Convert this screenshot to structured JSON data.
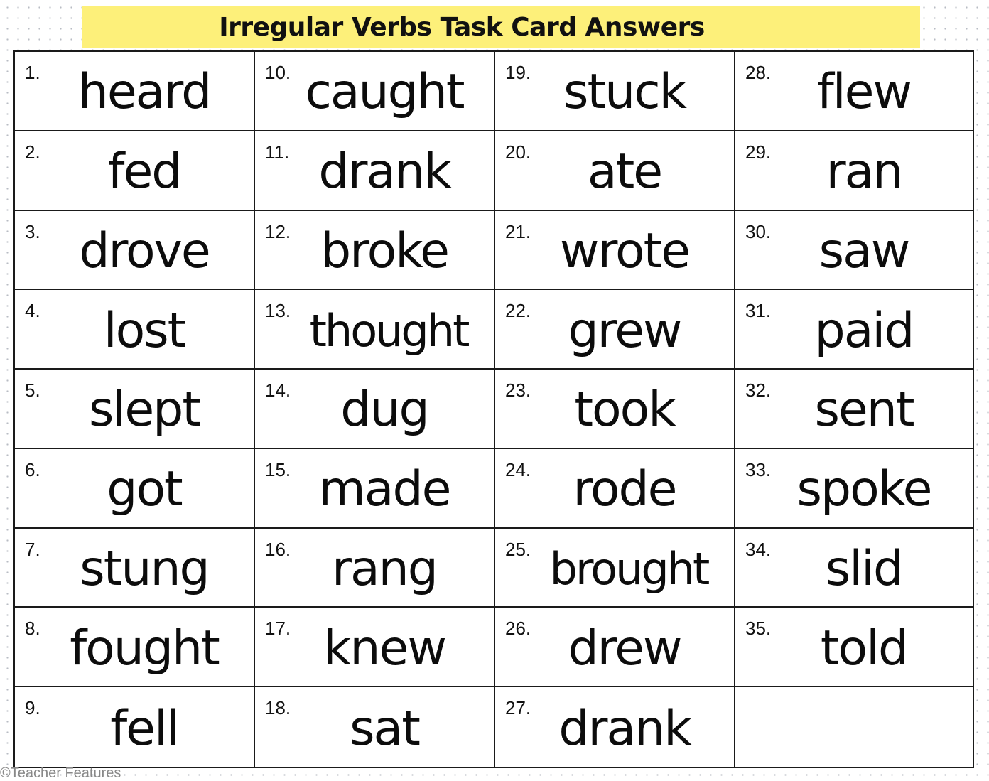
{
  "title": "Irregular Verbs Task Card Answers",
  "colors": {
    "banner": "#fdf07a",
    "grid_lines": "#1a1a1a",
    "text": "#0c0c0c"
  },
  "columns": [
    [
      {
        "number": "1.",
        "answer": "heard"
      },
      {
        "number": "2.",
        "answer": "fed"
      },
      {
        "number": "3.",
        "answer": "drove"
      },
      {
        "number": "4.",
        "answer": "lost"
      },
      {
        "number": "5.",
        "answer": "slept"
      },
      {
        "number": "6.",
        "answer": "got"
      },
      {
        "number": "7.",
        "answer": "stung"
      },
      {
        "number": "8.",
        "answer": "fought"
      },
      {
        "number": "9.",
        "answer": "fell"
      }
    ],
    [
      {
        "number": "10.",
        "answer": "caught"
      },
      {
        "number": "11.",
        "answer": "drank"
      },
      {
        "number": "12.",
        "answer": "broke"
      },
      {
        "number": "13.",
        "answer": "thought"
      },
      {
        "number": "14.",
        "answer": "dug"
      },
      {
        "number": "15.",
        "answer": "made"
      },
      {
        "number": "16.",
        "answer": "rang"
      },
      {
        "number": "17.",
        "answer": "knew"
      },
      {
        "number": "18.",
        "answer": "sat"
      }
    ],
    [
      {
        "number": "19.",
        "answer": "stuck"
      },
      {
        "number": "20.",
        "answer": "ate"
      },
      {
        "number": "21.",
        "answer": "wrote"
      },
      {
        "number": "22.",
        "answer": "grew"
      },
      {
        "number": "23.",
        "answer": "took"
      },
      {
        "number": "24.",
        "answer": "rode"
      },
      {
        "number": "25.",
        "answer": "brought"
      },
      {
        "number": "26.",
        "answer": "drew"
      },
      {
        "number": "27.",
        "answer": "drank"
      }
    ],
    [
      {
        "number": "28.",
        "answer": "flew"
      },
      {
        "number": "29.",
        "answer": "ran"
      },
      {
        "number": "30.",
        "answer": "saw"
      },
      {
        "number": "31.",
        "answer": "paid"
      },
      {
        "number": "32.",
        "answer": "sent"
      },
      {
        "number": "33.",
        "answer": "spoke"
      },
      {
        "number": "34.",
        "answer": "slid"
      },
      {
        "number": "35.",
        "answer": "told"
      },
      {
        "number": "",
        "answer": ""
      }
    ]
  ],
  "footer": {
    "credit": "©Teacher Features"
  }
}
